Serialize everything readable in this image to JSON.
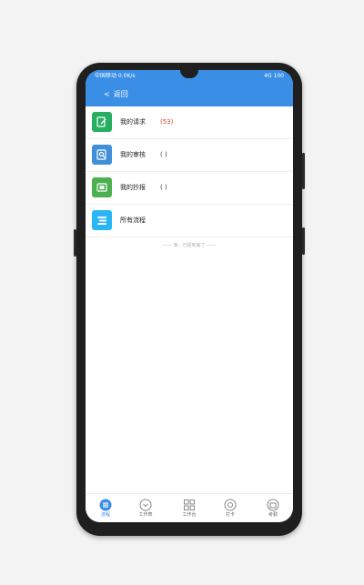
{
  "status_bar": {
    "left_text": "中国移动 0.0K/s",
    "right_text": "4G 100"
  },
  "nav": {
    "back_label": "返回"
  },
  "list": {
    "items": [
      {
        "label": "我的请求",
        "count": "(53)",
        "icon": "edit-document-icon",
        "color": "#27ae60"
      },
      {
        "label": "我的审核",
        "count": "( )",
        "icon": "search-document-icon",
        "color": "#3f8fd9"
      },
      {
        "label": "我的抄报",
        "count": "( )",
        "icon": "report-icon",
        "color": "#4caf50"
      },
      {
        "label": "所有流程",
        "count": "",
        "icon": "flow-list-icon",
        "color": "#29b6f6"
      }
    ]
  },
  "end_text": "—— 亲，已经到底了 ——",
  "tabbar": {
    "tabs": [
      {
        "label": "流程",
        "icon": "flow-icon",
        "active": true
      },
      {
        "label": "工作表",
        "icon": "worksheet-icon",
        "active": false
      },
      {
        "label": "工作台",
        "icon": "grid-icon",
        "active": false
      },
      {
        "label": "打卡",
        "icon": "clock-in-icon",
        "active": false
      },
      {
        "label": "考勤",
        "icon": "attendance-icon",
        "active": false
      }
    ]
  },
  "colors": {
    "accent": "#3a8ee6",
    "alert": "#e53935"
  }
}
